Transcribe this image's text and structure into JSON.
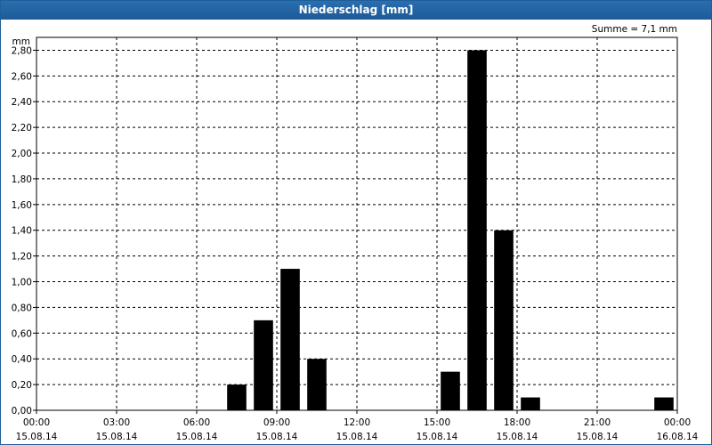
{
  "window": {
    "title": "Niederschlag [mm]"
  },
  "chart_data": {
    "type": "bar",
    "ylabel": "mm",
    "annotation": "Summe = 7,1 mm",
    "ylim": [
      0,
      2.9
    ],
    "yticks": [
      "0,00",
      "0,20",
      "0,40",
      "0,60",
      "0,80",
      "1,00",
      "1,20",
      "1,40",
      "1,60",
      "1,80",
      "2,00",
      "2,20",
      "2,40",
      "2,60",
      "2,80"
    ],
    "xlim_hours": [
      0,
      24
    ],
    "xticks": [
      {
        "time": "00:00",
        "date": "15.08.14"
      },
      {
        "time": "03:00",
        "date": "15.08.14"
      },
      {
        "time": "06:00",
        "date": "15.08.14"
      },
      {
        "time": "09:00",
        "date": "15.08.14"
      },
      {
        "time": "12:00",
        "date": "15.08.14"
      },
      {
        "time": "15:00",
        "date": "15.08.14"
      },
      {
        "time": "18:00",
        "date": "15.08.14"
      },
      {
        "time": "21:00",
        "date": "15.08.14"
      },
      {
        "time": "00:00",
        "date": "16.08.14"
      }
    ],
    "bars": [
      {
        "time": "07:30",
        "value": 0.2
      },
      {
        "time": "08:30",
        "value": 0.7
      },
      {
        "time": "09:30",
        "value": 1.1
      },
      {
        "time": "10:30",
        "value": 0.4
      },
      {
        "time": "15:30",
        "value": 0.3
      },
      {
        "time": "16:30",
        "value": 2.8
      },
      {
        "time": "17:30",
        "value": 1.4
      },
      {
        "time": "18:30",
        "value": 0.1
      },
      {
        "time": "23:30",
        "value": 0.1
      }
    ],
    "bar_color": "#000000",
    "grid": true
  }
}
